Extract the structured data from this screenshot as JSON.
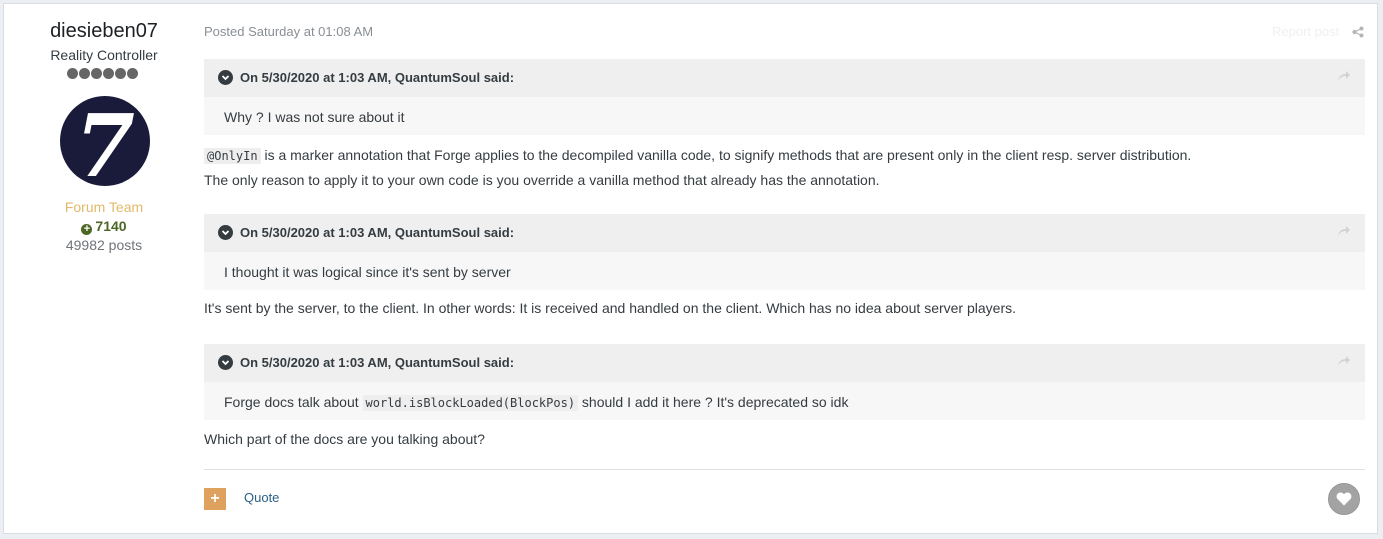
{
  "author": {
    "name": "diesieben07",
    "title": "Reality Controller",
    "rank_pips": 6,
    "avatar_glyph": "7",
    "group": "Forum Team",
    "reputation": "7140",
    "post_count": "49982 posts"
  },
  "post": {
    "meta": "Posted Saturday at 01:08 AM",
    "report_label": "Report post",
    "quotes": [
      {
        "citation": "On 5/30/2020 at 1:03 AM, QuantumSoul said:",
        "body": "Why ? I was not sure about it"
      },
      {
        "citation": "On 5/30/2020 at 1:03 AM, QuantumSoul said:",
        "body": "I thought it was logical since it's sent by server"
      },
      {
        "citation": "On 5/30/2020 at 1:03 AM, QuantumSoul said:",
        "body_before": "Forge docs talk about ",
        "body_code": "world.isBlockLoaded(BlockPos)",
        "body_after": " should I add it here ? It's deprecated so idk"
      }
    ],
    "reply1_code": "@OnlyIn",
    "reply1_line1": " is a marker annotation that Forge applies to the decompiled vanilla code, to signify methods that are present only in the client resp. server distribution.",
    "reply1_line2": "The only reason to apply it to your own code is you override a vanilla method that already has the annotation.",
    "reply2": "It's sent by the server, to the client. In other words: It is received and handled on the client. Which has no idea about server players.",
    "reply3": "Which part of the docs are you talking about?"
  },
  "footer": {
    "multiquote_label": "+",
    "quote_label": "Quote"
  },
  "icons": {
    "chevron": "chevron-down-icon",
    "share": "share-icon",
    "arrow": "go-to-quote-arrow-icon",
    "like": "heart-icon"
  }
}
